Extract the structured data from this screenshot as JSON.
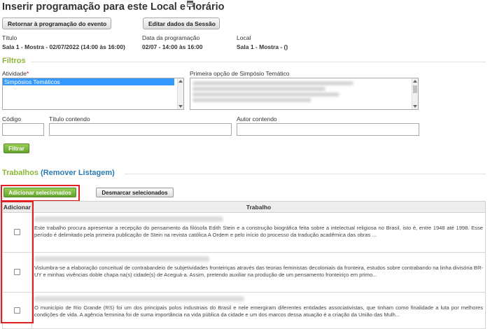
{
  "page": {
    "title": "Inserir programação para este Local e Horário"
  },
  "toolbar": {
    "back_button": "Retornar à programação do evento",
    "edit_button": "Editar dados da Sessão"
  },
  "session_info": {
    "titulo_label": "Título",
    "titulo_value": "Sala 1 - Mostra - 02/07/2022 (14:00 às 16:00)",
    "data_label": "Data da programação",
    "data_value": "02/07 - 14:00 às 16:00",
    "local_label": "Local",
    "local_value": "Sala 1 - Mostra - ()"
  },
  "filters": {
    "section_title": "Filtros",
    "atividade_label": "Atividade",
    "atividade_options": [
      "Simpósios Temáticos"
    ],
    "primeira_opcao_label": "Primeira opção de Simpósio Temático",
    "codigo_label": "Código",
    "titulo_contendo_label": "Título contendo",
    "autor_contendo_label": "Autor contendo",
    "filter_button": "Filtrar"
  },
  "works": {
    "section_title": "Trabalhos",
    "remove_link": "(Remover Listagem)",
    "add_selected_button": "Adicionar selecionados",
    "unmark_selected_button": "Desmarcar selecionados",
    "columns": [
      "Adicionar",
      "Trabalho"
    ],
    "rows": [
      {
        "text": "Este trabalho procura apresentar a recepção do pensamento da filósofa Edith Stein e a construção biográfica feita sobre a intelectual religiosa no Brasil, isto é, entre 1948 até 1998. Esse período é delimitado pela primeira publicação de Stein na revista católica A Ordem e pelo início do processo da tradução acadêmica das obras ..."
      },
      {
        "text": "Vislumbra-se a elaboração conceitual de contrabandeio de subjetividades fronteiriças através das teorias feministas decoloniais da fronteira, estudos sobre contrabando na linha divisória BR-UY e minhas vivências doble chapa na(s) cidade(s) de Aceguá-a. Assim, pretendo auxiliar na produção de um pensamento fronteiriço em primo..."
      },
      {
        "text": "O município de Rio Grande (RS) foi um dos principais polos industriais do Brasil e nele emergiram diferentes entidades associativistas, que tinham como finalidade a luta por melhores condições de vida. A agência feminina foi de suma importância na vida pública da cidade e um dos marcos dessa atuação é a criação da União das Mulh..."
      }
    ]
  },
  "colors": {
    "accent_green": "#8bb63a",
    "link_blue": "#2a7ab0",
    "highlight_red": "#e02020",
    "selection_blue": "#3399ff"
  }
}
